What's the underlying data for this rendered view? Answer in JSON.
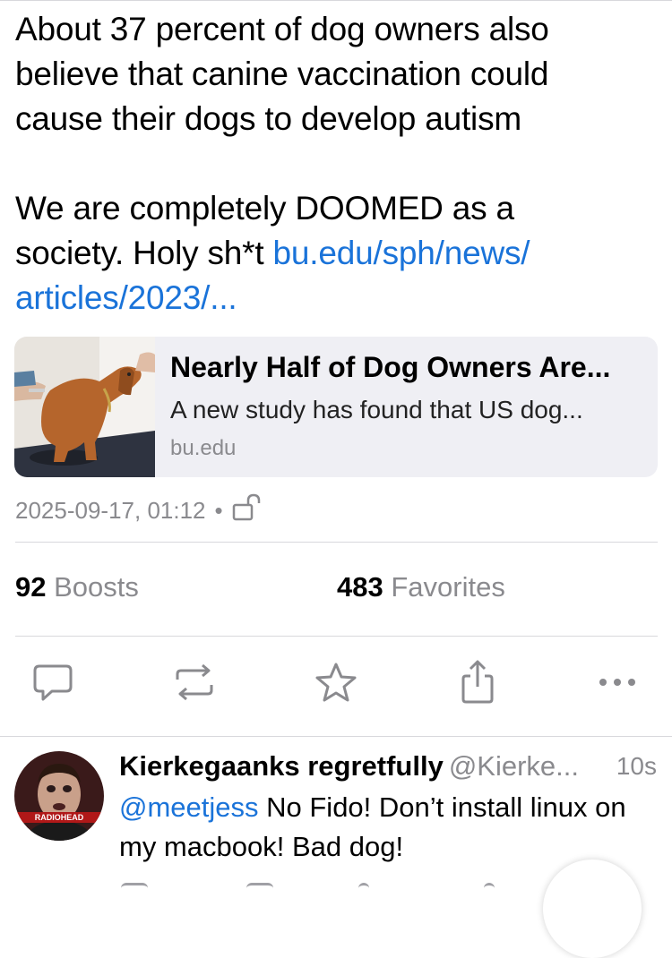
{
  "post": {
    "line1": "About 37 percent of dog owners also",
    "line2": "believe that canine vaccination could",
    "line3": "cause their dogs to develop autism",
    "line4": "We are completely DOOMED as a",
    "line5_text": "society. Holy sh*t ",
    "line5_link": "bu.edu/sph/news/",
    "line6_link": "articles/2023/..."
  },
  "card": {
    "title": "Nearly Half of Dog Owners Are...",
    "description": "A new study has found that US dog...",
    "domain": "bu.edu"
  },
  "meta": {
    "timestamp": "2025-09-17, 01:12",
    "separator": "•",
    "visibility_icon": "unlock-icon"
  },
  "stats": {
    "boosts_count": "92",
    "boosts_label": "Boosts",
    "favorites_count": "483",
    "favorites_label": "Favorites"
  },
  "actions": [
    "reply-icon",
    "boost-icon",
    "favorite-icon",
    "share-icon",
    "more-icon"
  ],
  "reply": {
    "display_name": "Kierkegaanks regretfully",
    "handle": "@Kierke...",
    "time": "10s",
    "mention": "@meetjess",
    "text_rest": " No Fido! Don’t install linux on",
    "text_line2": "my macbook! Bad dog!",
    "avatar_badge": "RADIOHEAD"
  },
  "colors": {
    "link": "#1a73d9",
    "secondary": "#8a8a8e",
    "card_bg": "#efeff4"
  }
}
